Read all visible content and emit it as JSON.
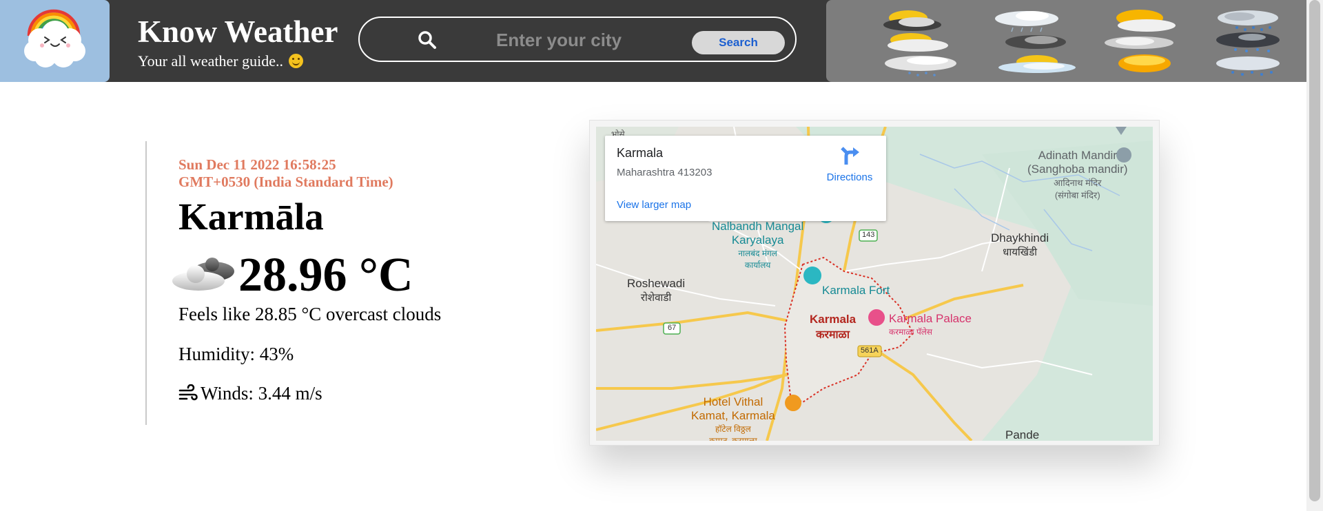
{
  "header": {
    "title": "Know Weather",
    "tagline": "Your all weather guide..",
    "logo_icon": "rainbow-cloud-icon",
    "search": {
      "placeholder": "Enter your city",
      "value": "",
      "button_label": "Search",
      "icon": "search-icon"
    },
    "weather_icons": [
      "sun-dark-cloud-icon",
      "cloud-light-rain-icon",
      "sun-cloud-icon",
      "cloud-rain-icon",
      "sun-cloud-icon",
      "dark-cloud-icon",
      "overcast-icon",
      "dark-rain-cloud-icon",
      "cloud-rain-icon",
      "sun-cloud-icon",
      "sun-icon",
      "cloud-rain-icon"
    ]
  },
  "weather": {
    "date": "Sun Dec 11 2022 16:58:25",
    "timezone": "GMT+0530 (India Standard Time)",
    "city": "Karmāla",
    "temperature": "28.96 °C",
    "condition_icon": "overcast-clouds-icon",
    "feels_like": "Feels like 28.85 °C overcast clouds",
    "humidity": "Humidity: 43%",
    "wind_icon": "wind-icon",
    "winds": "Winds: 3.44 m/s"
  },
  "map": {
    "place": {
      "name": "Karmala",
      "address": "Maharashtra 413203",
      "directions_label": "Directions",
      "larger_map_label": "View larger map"
    },
    "labels": {
      "top_left": "भोसे",
      "adinath_1": "Adinath Mandir",
      "adinath_2": "(Sanghoba mandir)",
      "adinath_3": "आदिनाथ मंदिर",
      "adinath_4": "(संगोबा मंदिर)",
      "nalbandh_1": "Nalbandh Mangal",
      "nalbandh_2": "Karyalaya",
      "nalbandh_3": "नालबंद मंगल",
      "nalbandh_4": "कार्यालय",
      "dhaykhindi_1": "Dhaykhindi",
      "dhaykhindi_2": "धायखिंडी",
      "roshewadi_1": "Roshewadi",
      "roshewadi_2": "रोशेवाडी",
      "karmala_fort": "Karmala Fort",
      "karmala_1": "Karmala",
      "karmala_2": "करमाळा",
      "palace_1": "Karmala Palace",
      "palace_2": "करमाळा पॅलेस",
      "hotel_1": "Hotel Vithal",
      "hotel_2": "Kamat, Karmala",
      "hotel_3": "हॉटेल विठ्ठल",
      "hotel_4": "कामत, करमाळा",
      "pande": "Pande",
      "route_143": "143",
      "route_67": "67",
      "route_561a": "561A"
    },
    "colors": {
      "land": "#e6e4df",
      "green": "#d3e7dc",
      "road": "#f6c84c",
      "boundary": "#d93025",
      "link": "#1a73e8"
    }
  },
  "colors": {
    "header_bg": "#3a3a3a",
    "logo_bg": "#9dbfe0",
    "icon_strip_bg": "#7d7d7d",
    "date_text": "#e07a5f"
  }
}
